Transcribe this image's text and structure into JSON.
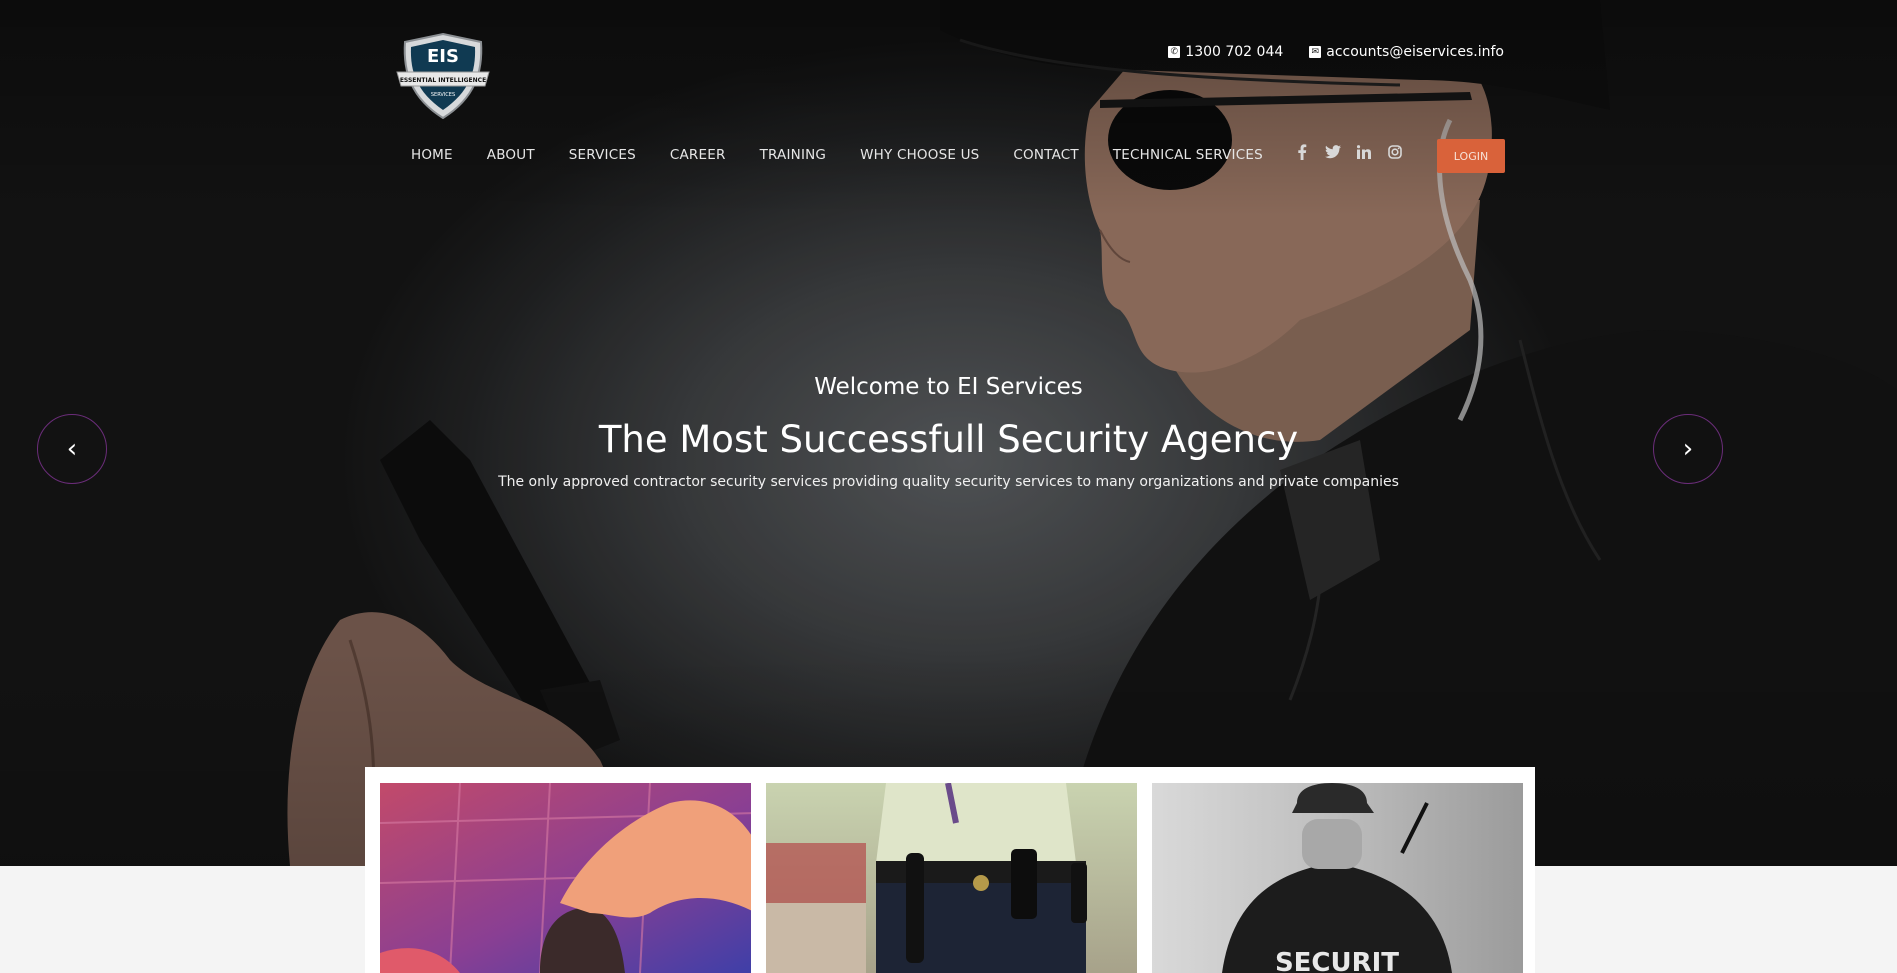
{
  "brand": {
    "logo_text": "EIS",
    "logo_ribbon": "ESSENTIAL INTELLIGENCE",
    "logo_sub": "SERVICES"
  },
  "contact": {
    "phone": "1300 702 044",
    "email": "accounts@eiservices.info"
  },
  "nav": {
    "items": [
      "HOME",
      "ABOUT",
      "SERVICES",
      "CAREER",
      "TRAINING",
      "WHY CHOOSE US",
      "CONTACT",
      "TECHNICAL SERVICES"
    ]
  },
  "social": {
    "facebook": "f",
    "twitter": "t",
    "linkedin": "in",
    "instagram": "ig"
  },
  "login_label": "LOGIN",
  "slider": {
    "welcome": "Welcome to EI Services",
    "headline": "The Most Successfull Security Agency",
    "sub": "The only approved contractor security services providing quality security services to many organizations and private companies",
    "prev": "‹",
    "next": "›"
  },
  "cards": {
    "card3_text": "SECURIT"
  },
  "colors": {
    "accent": "#d9623a",
    "arrow_border": "#6b2d7a"
  }
}
